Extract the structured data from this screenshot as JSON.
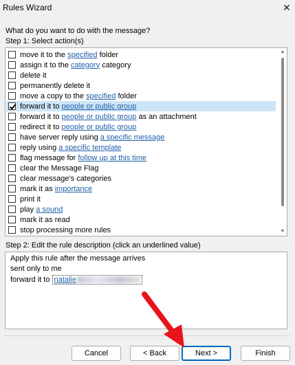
{
  "window": {
    "title": "Rules Wizard",
    "close_icon": "close-icon"
  },
  "question": "What do you want to do with the message?",
  "step1_label": "Step 1: Select action(s)",
  "actions": [
    {
      "parts": [
        {
          "t": "move it to the "
        },
        {
          "t": "specified",
          "link": true
        },
        {
          "t": " folder"
        }
      ],
      "checked": false
    },
    {
      "parts": [
        {
          "t": "assign it to the "
        },
        {
          "t": "category",
          "link": true
        },
        {
          "t": " category"
        }
      ],
      "checked": false
    },
    {
      "parts": [
        {
          "t": "delete it"
        }
      ],
      "checked": false
    },
    {
      "parts": [
        {
          "t": "permanently delete it"
        }
      ],
      "checked": false
    },
    {
      "parts": [
        {
          "t": "move a copy to the "
        },
        {
          "t": "specified",
          "link": true
        },
        {
          "t": " folder"
        }
      ],
      "checked": false
    },
    {
      "parts": [
        {
          "t": "forward it to "
        },
        {
          "t": "people or public group",
          "link": true
        }
      ],
      "checked": true,
      "selected": true
    },
    {
      "parts": [
        {
          "t": "forward it to "
        },
        {
          "t": "people or public group",
          "link": true
        },
        {
          "t": " as an attachment"
        }
      ],
      "checked": false
    },
    {
      "parts": [
        {
          "t": "redirect it to "
        },
        {
          "t": "people or public group",
          "link": true
        }
      ],
      "checked": false
    },
    {
      "parts": [
        {
          "t": "have server reply using "
        },
        {
          "t": "a specific message",
          "link": true
        }
      ],
      "checked": false
    },
    {
      "parts": [
        {
          "t": "reply using "
        },
        {
          "t": "a specific template",
          "link": true
        }
      ],
      "checked": false
    },
    {
      "parts": [
        {
          "t": "flag message for "
        },
        {
          "t": "follow up at this time",
          "link": true
        }
      ],
      "checked": false
    },
    {
      "parts": [
        {
          "t": "clear the Message Flag"
        }
      ],
      "checked": false
    },
    {
      "parts": [
        {
          "t": "clear message's categories"
        }
      ],
      "checked": false
    },
    {
      "parts": [
        {
          "t": "mark it as "
        },
        {
          "t": "importance",
          "link": true
        }
      ],
      "checked": false
    },
    {
      "parts": [
        {
          "t": "print it"
        }
      ],
      "checked": false
    },
    {
      "parts": [
        {
          "t": "play "
        },
        {
          "t": "a sound",
          "link": true
        }
      ],
      "checked": false
    },
    {
      "parts": [
        {
          "t": "mark it as read"
        }
      ],
      "checked": false
    },
    {
      "parts": [
        {
          "t": "stop processing more rules"
        }
      ],
      "checked": false
    }
  ],
  "step2_label": "Step 2: Edit the rule description (click an underlined value)",
  "description": {
    "line1": "Apply this rule after the message arrives",
    "line2": "sent only to me",
    "line3_prefix": "forward it to ",
    "recipient": "natalie"
  },
  "buttons": {
    "cancel": "Cancel",
    "back": "< Back",
    "next": "Next >",
    "finish": "Finish"
  },
  "colors": {
    "link": "#1f5fa8",
    "selection": "#cce4f7",
    "arrow": "#e8131b"
  }
}
